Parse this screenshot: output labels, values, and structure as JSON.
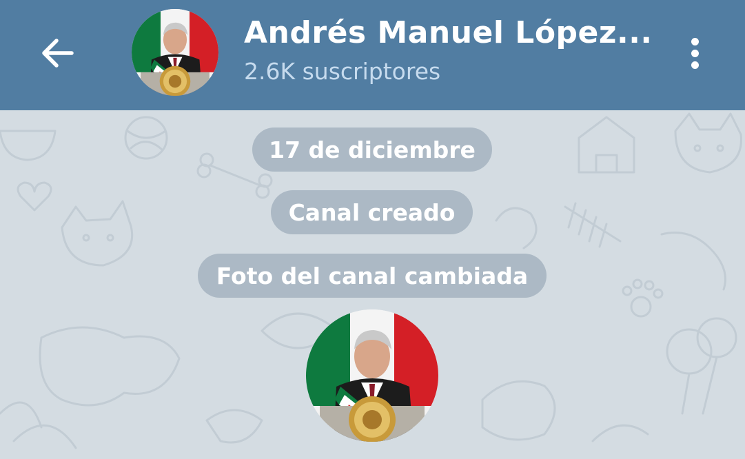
{
  "header": {
    "title": "Andrés Manuel López...",
    "subscribers": "2.6K suscriptores"
  },
  "icons": {
    "back": "arrow-left-icon",
    "menu": "more-vertical-icon",
    "avatar": "channel-avatar"
  },
  "messages": [
    {
      "text": "17 de diciembre",
      "type": "date"
    },
    {
      "text": "Canal creado",
      "type": "service"
    },
    {
      "text": "Foto del canal cambiada",
      "type": "service"
    }
  ],
  "colors": {
    "header_bg": "#517da2",
    "chat_bg": "#d4dce2",
    "pill_bg": "#a0b0bc",
    "subtitle": "#c6dbee"
  }
}
